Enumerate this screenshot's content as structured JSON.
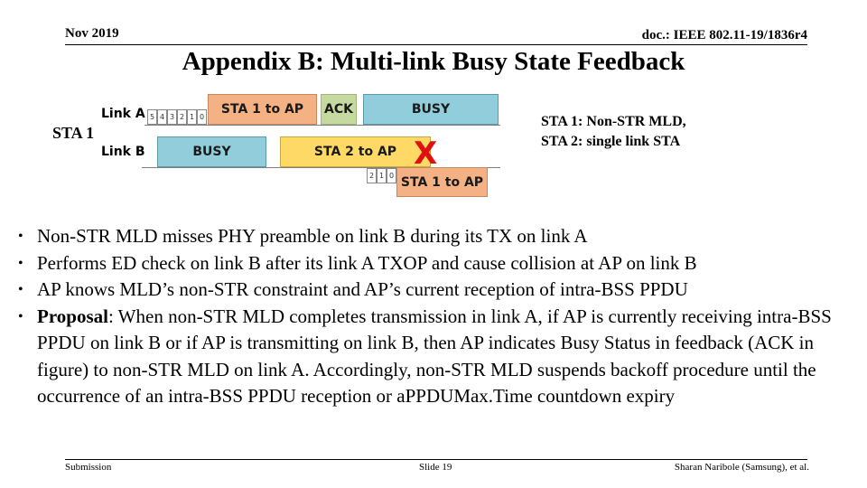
{
  "header": {
    "date": "Nov 2019",
    "doc_id": "doc.: IEEE 802.11-19/1836r4"
  },
  "title": "Appendix B: Multi-link Busy State Feedback",
  "diagram": {
    "station_label": "STA 1",
    "legend_lines": [
      "STA 1: Non-STR MLD,",
      "STA 2: single link STA"
    ],
    "link_a": {
      "label": "Link A",
      "backoff": [
        "5",
        "4",
        "3",
        "2",
        "1",
        "0"
      ],
      "frames": [
        {
          "label": "STA 1 to AP",
          "color": "#f4b183"
        },
        {
          "label": "ACK",
          "color": "#c5d9a0"
        },
        {
          "label": "BUSY",
          "color": "#92cddc"
        }
      ]
    },
    "link_b": {
      "label": "Link B",
      "frames": [
        {
          "label": "BUSY",
          "color": "#92cddc"
        },
        {
          "label": "STA 2 to AP",
          "color": "#ffd966"
        }
      ],
      "collision_mark": "X",
      "collision_color": "#e01010",
      "backoff": [
        "2",
        "1",
        "0"
      ],
      "late_frame": {
        "label": "STA 1 to AP",
        "color": "#f4b183"
      }
    }
  },
  "bullets": [
    {
      "bold": "",
      "text": "Non-STR MLD misses PHY preamble on link B during its TX on link A"
    },
    {
      "bold": "",
      "text": "Performs ED check on link B after its link A TXOP and cause collision at AP on link B"
    },
    {
      "bold": "",
      "text": "AP knows MLD’s non-STR constraint and AP’s current reception of intra-BSS PPDU"
    },
    {
      "bold": "Proposal",
      "text": ": When non-STR MLD completes transmission in link A, if AP is currently receiving intra-BSS PPDU on link B or if AP is transmitting on link B, then AP indicates Busy Status in feedback (ACK in figure) to non-STR MLD on link A. Accordingly, non-STR MLD suspends backoff procedure until the occurrence of an intra-BSS PPDU reception or aPPDUMax.Time countdown expiry"
    }
  ],
  "footer": {
    "left": "Submission",
    "center": "Slide 19",
    "right": "Sharan Naribole (Samsung), et al."
  }
}
